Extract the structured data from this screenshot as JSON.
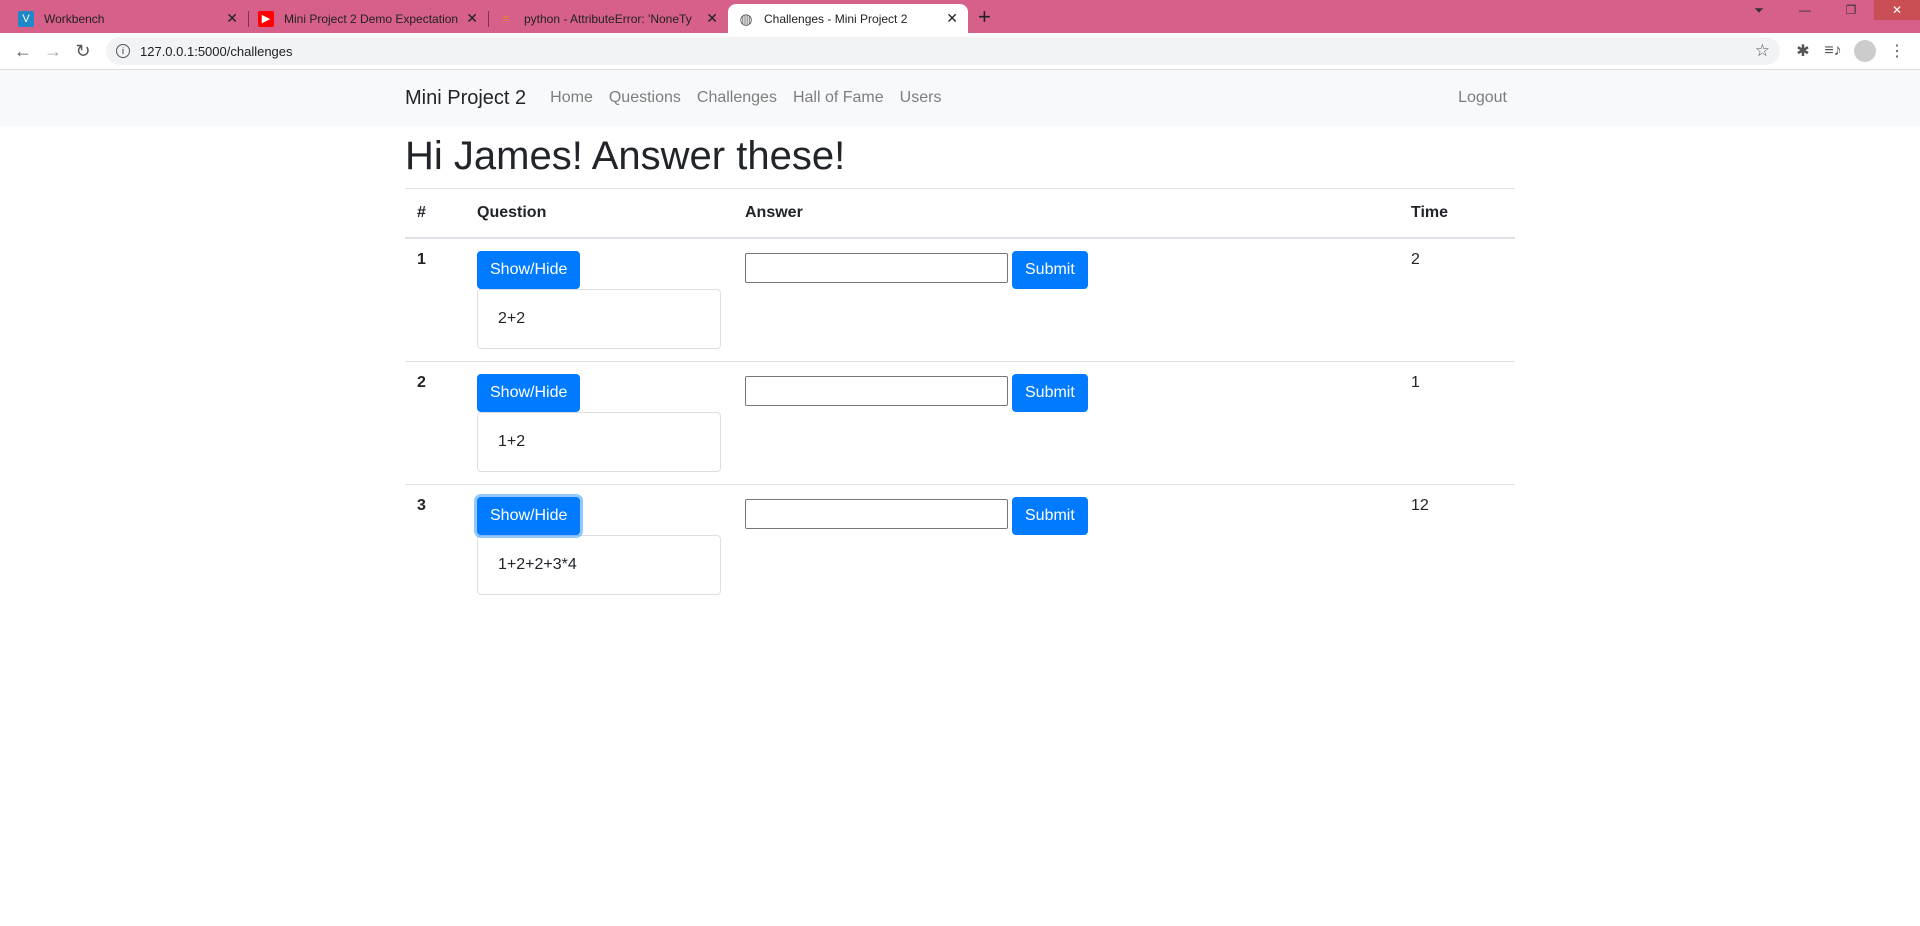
{
  "browser": {
    "tabs": [
      {
        "title": "Workbench",
        "icon": "vite-icon",
        "color": "#1e88c8",
        "glyph": "V"
      },
      {
        "title": "Mini Project 2 Demo Expectation",
        "icon": "youtube-icon",
        "color": "#ff0000",
        "glyph": "▶"
      },
      {
        "title": "python - AttributeError: 'NoneTy",
        "icon": "stackoverflow-icon",
        "color": "#f48024",
        "glyph": "≡"
      },
      {
        "title": "Challenges - Mini Project 2",
        "icon": "globe-icon",
        "color": "#555555",
        "glyph": "◍"
      }
    ],
    "url": "127.0.0.1:5000/challenges"
  },
  "navbar": {
    "brand": "Mini Project 2",
    "links": [
      "Home",
      "Questions",
      "Challenges",
      "Hall of Fame",
      "Users"
    ],
    "logout": "Logout"
  },
  "page": {
    "heading": "Hi James! Answer these!"
  },
  "table": {
    "headers": [
      "#",
      "Question",
      "Answer",
      "Time"
    ],
    "toggle_label": "Show/Hide",
    "submit_label": "Submit",
    "rows": [
      {
        "num": "1",
        "question": "2+2",
        "answer": "",
        "time": "2"
      },
      {
        "num": "2",
        "question": "1+2",
        "answer": "",
        "time": "1"
      },
      {
        "num": "3",
        "question": "1+2+2+3*4",
        "answer": "",
        "time": "12"
      }
    ]
  },
  "colors": {
    "tabbar": "#d6608a",
    "primary": "#007bff"
  }
}
